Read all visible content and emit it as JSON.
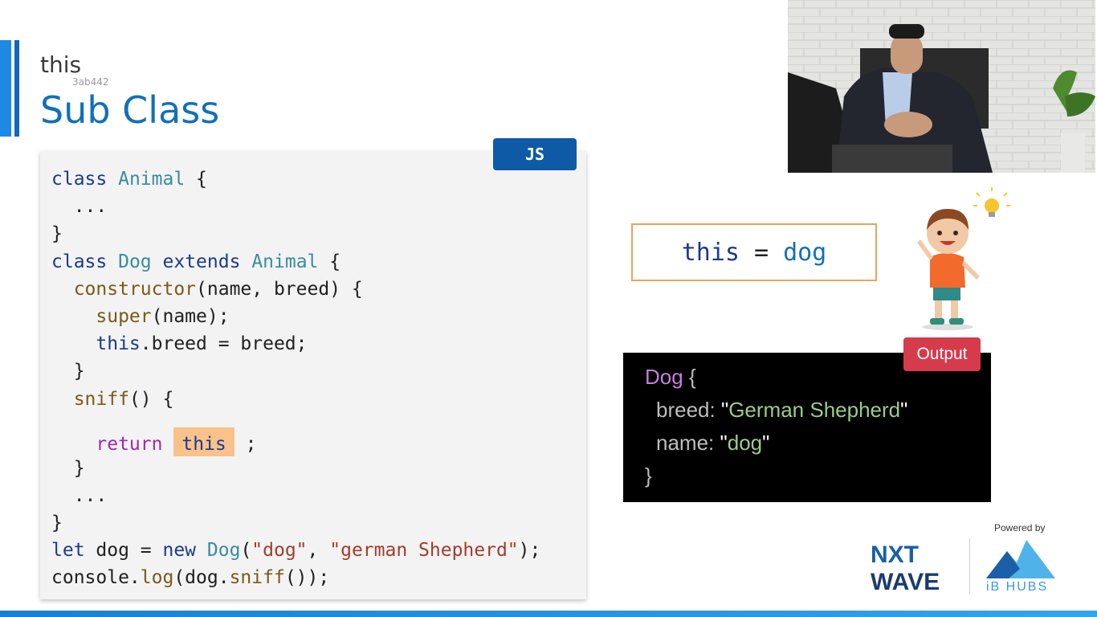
{
  "header": {
    "topic": "this",
    "code_id": "3ab442",
    "title": "Sub Class"
  },
  "code_panel": {
    "language_badge": "JS"
  },
  "code_lines": [
    {
      "segments": [
        [
          "k",
          "class"
        ],
        [
          "p",
          " "
        ],
        [
          "cls",
          "Animal"
        ],
        [
          "p",
          " {"
        ]
      ]
    },
    {
      "segments": [
        [
          "p",
          "  ..."
        ]
      ]
    },
    {
      "segments": [
        [
          "p",
          "}"
        ]
      ]
    },
    {
      "segments": [
        [
          "k",
          "class"
        ],
        [
          "p",
          " "
        ],
        [
          "cls",
          "Dog"
        ],
        [
          "p",
          " "
        ],
        [
          "k",
          "extends"
        ],
        [
          "p",
          " "
        ],
        [
          "cls",
          "Animal"
        ],
        [
          "p",
          " {"
        ]
      ]
    },
    {
      "segments": [
        [
          "p",
          "  "
        ],
        [
          "fn",
          "constructor"
        ],
        [
          "p",
          "(name, breed) {"
        ]
      ]
    },
    {
      "segments": [
        [
          "p",
          "    "
        ],
        [
          "fn",
          "super"
        ],
        [
          "p",
          "(name);"
        ]
      ]
    },
    {
      "segments": [
        [
          "p",
          "    "
        ],
        [
          "k",
          "this"
        ],
        [
          "p",
          ".breed = breed;"
        ]
      ]
    },
    {
      "segments": [
        [
          "p",
          "  }"
        ]
      ]
    },
    {
      "segments": [
        [
          "p",
          "  "
        ],
        [
          "fn",
          "sniff"
        ],
        [
          "p",
          "() {"
        ]
      ]
    },
    {
      "tall": true,
      "segments": [
        [
          "p",
          "    "
        ],
        [
          "ret",
          "return"
        ],
        [
          "p",
          " "
        ],
        [
          "hl",
          "this"
        ],
        [
          "p",
          " ;"
        ]
      ]
    },
    {
      "segments": [
        [
          "p",
          "  }"
        ]
      ]
    },
    {
      "segments": [
        [
          "p",
          "  ..."
        ]
      ]
    },
    {
      "segments": [
        [
          "p",
          "}"
        ]
      ]
    },
    {
      "segments": [
        [
          "k",
          "let"
        ],
        [
          "p",
          " dog = "
        ],
        [
          "k",
          "new"
        ],
        [
          "p",
          " "
        ],
        [
          "cls",
          "Dog"
        ],
        [
          "p",
          "("
        ],
        [
          "str",
          "\"dog\""
        ],
        [
          "p",
          ", "
        ],
        [
          "str",
          "\"german Shepherd\""
        ],
        [
          "p",
          ");"
        ]
      ]
    },
    {
      "segments": [
        [
          "p",
          "console."
        ],
        [
          "fn",
          "log"
        ],
        [
          "p",
          "(dog."
        ],
        [
          "fn",
          "sniff"
        ],
        [
          "p",
          "());"
        ]
      ]
    }
  ],
  "this_box": {
    "keyword": "this",
    "equals": "=",
    "value": "dog"
  },
  "output": {
    "badge": "Output",
    "class_name": "Dog",
    "open_brace": "{",
    "close_brace": "}",
    "fields": [
      {
        "key": "breed:",
        "value": "\"German Shepherd\"",
        "value_text": "German Shepherd"
      },
      {
        "key": "name:",
        "value": "\"dog\"",
        "value_text": "dog"
      }
    ]
  },
  "branding": {
    "powered_by": "Powered by",
    "nxt_line1": "NXT",
    "nxt_line2": "WAVE",
    "ibhubs": "iB HUBS"
  },
  "colors": {
    "title": "#1270b8",
    "js_badge": "#0e5aa7",
    "output_badge": "#d63b4c",
    "highlight": "#f8c28a",
    "this_box_border": "#e8a45a"
  }
}
